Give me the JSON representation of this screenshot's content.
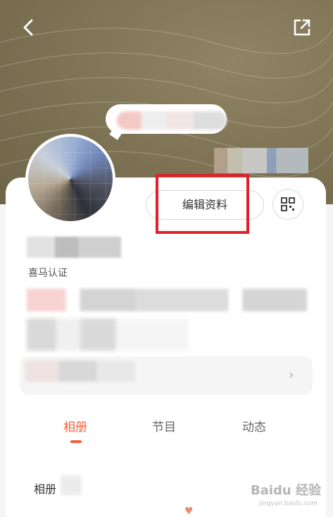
{
  "nav": {
    "back_icon": "chevron-left-icon",
    "share_icon": "share-out-icon"
  },
  "profile": {
    "edit_label": "编辑资料",
    "verify_text": "喜马认证",
    "qr_icon": "qrcode-icon"
  },
  "info_bar": {
    "chevron": "›"
  },
  "tabs": [
    {
      "label": "相册",
      "active": true
    },
    {
      "label": "节目",
      "active": false
    },
    {
      "label": "动态",
      "active": false
    }
  ],
  "album": {
    "title": "相册"
  },
  "watermark": {
    "brand": "Baidu 经验",
    "url": "jingyan.baidu.com"
  },
  "colors": {
    "accent": "#f2613b",
    "highlight": "#e0202a",
    "banner": "#7d7253"
  }
}
